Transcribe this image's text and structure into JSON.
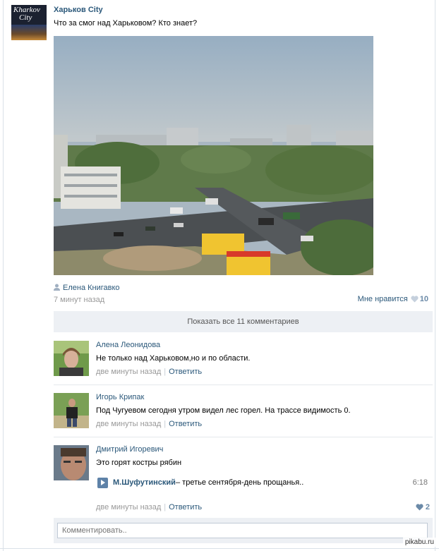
{
  "post": {
    "group_name": "Харьков City",
    "avatar_text_line1": "Kharkov",
    "avatar_text_line2": "City",
    "text": "Что за смог над Харьковом? Кто знает?",
    "signer": "Елена Книгавко",
    "time": "7 минут назад",
    "like_label": "Мне нравится",
    "like_count": "10"
  },
  "show_all_comments": "Показать все 11 комментариев",
  "comments": [
    {
      "author": "Алена Леонидова",
      "text": "Не только над Харьковом,но и по области.",
      "time": "две минуты назад",
      "reply": "Ответить"
    },
    {
      "author": "Игорь Крипак",
      "text": "Под Чугуевом сегодня утром видел лес горел. На трассе видимость 0.",
      "time": "две минуты назад",
      "reply": "Ответить"
    },
    {
      "author": "Дмитрий Игоревич",
      "text": "Это горят костры рябин",
      "audio": {
        "artist": "М.Шуфутинский",
        "title": " – третье сентября-день прощанья..",
        "duration": "6:18"
      },
      "time": "две минуты назад",
      "reply": "Ответить",
      "like_count": "2"
    }
  ],
  "comment_input": {
    "placeholder": "Комментировать.."
  },
  "watermark": "pikabu.ru",
  "colors": {
    "link": "#2b587a",
    "muted": "#999999",
    "panel": "#edf0f4",
    "accent": "#5e82a8"
  }
}
